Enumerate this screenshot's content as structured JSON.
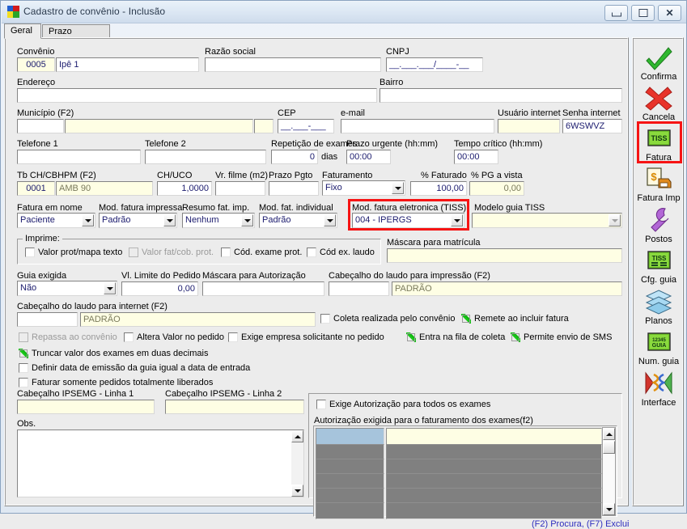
{
  "window": {
    "title": "Cadastro de convênio - Inclusão",
    "buttons": {
      "minimize": "—",
      "maximize": "❐",
      "close": "✕"
    }
  },
  "tabs": [
    {
      "label": "Geral",
      "active": true
    },
    {
      "label": "Prazo Entrega",
      "active": false
    }
  ],
  "form": {
    "convenio_label": "Convênio",
    "convenio_code": "0005",
    "convenio_name": "Ipê 1",
    "razao_social_label": "Razão social",
    "razao_social_value": "",
    "cnpj_label": "CNPJ",
    "cnpj_value": "__.___.___/____-__",
    "endereco_label": "Endereço",
    "endereco_value": "",
    "bairro_label": "Bairro",
    "bairro_value": "",
    "municipio_label": "Município (F2)",
    "municipio_code": "",
    "municipio_name": "",
    "municipio_uf": "",
    "cep_label": "CEP",
    "cep_value": "__.___-___",
    "email_label": "e-mail",
    "email_value": "",
    "usuario_internet_label": "Usuário internet",
    "usuario_internet_value": "",
    "senha_internet_label": "Senha internet",
    "senha_internet_value": "6WSWVZ",
    "telefone1_label": "Telefone 1",
    "telefone1_value": "",
    "telefone2_label": "Telefone 2",
    "telefone2_value": "",
    "repeticao_label": "Repetição de exames",
    "repeticao_value": "0",
    "repeticao_unit": "dias",
    "prazo_urgente_label": "Prazo urgente (hh:mm)",
    "prazo_urgente_value": "00:00",
    "tempo_critico_label": "Tempo crítico (hh:mm)",
    "tempo_critico_value": "00:00",
    "tb_ch_label": "Tb CH/CBHPM (F2)",
    "tb_ch_code": "0001",
    "tb_ch_name": "AMB 90",
    "ch_uco_label": "CH/UCO",
    "ch_uco_value": "1,0000",
    "vr_filme_label": "Vr. filme (m2)",
    "vr_filme_value": "",
    "prazo_pgto_label": "Prazo Pgto",
    "prazo_pgto_value": "",
    "faturamento_label": "Faturamento",
    "faturamento_value": "Fixo",
    "pct_faturado_label": "% Faturado",
    "pct_faturado_value": "100,00",
    "pct_pg_vista_label": "% PG a vista",
    "pct_pg_vista_value": "0,00",
    "fatura_em_nome_label": "Fatura em nome",
    "fatura_em_nome_value": "Paciente",
    "mod_fatura_impressa_label": "Mod. fatura impressa",
    "mod_fatura_impressa_value": "Padrão",
    "resumo_fat_label": "Resumo fat. imp.",
    "resumo_fat_value": "Nenhum",
    "mod_fat_individual_label": "Mod. fat. individual",
    "mod_fat_individual_value": "Padrão",
    "mod_fatura_eletronica_label": "Mod. fatura eletronica (TISS)",
    "mod_fatura_eletronica_value": "004 - IPERGS",
    "modelo_guia_tiss_label": "Modelo guia TISS",
    "modelo_guia_tiss_value": "",
    "imprime_group_label": "Imprime:",
    "imprime_checkboxes": [
      {
        "label": "Valor prot/mapa texto",
        "checked": false,
        "disabled": false
      },
      {
        "label": "Valor fat/cob. prot.",
        "checked": false,
        "disabled": true
      },
      {
        "label": "Cód. exame prot.",
        "checked": false,
        "disabled": false
      },
      {
        "label": "Cód  ex. laudo",
        "checked": false,
        "disabled": false
      }
    ],
    "mascara_matricula_label": "Máscara para matrícula",
    "mascara_matricula_value": "",
    "guia_exigida_label": "Guia exigida",
    "guia_exigida_value": "Não",
    "vl_limite_label": "Vl. Limite do Pedido",
    "vl_limite_value": "0,00",
    "mascara_autorizacao_label": "Máscara para Autorização",
    "mascara_autorizacao_value": "",
    "cab_laudo_impressao_label": "Cabeçalho do laudo para impressão (F2)",
    "cab_laudo_impressao_code": "",
    "cab_laudo_impressao_value": "PADRÃO",
    "cab_laudo_internet_label": "Cabeçalho do laudo para internet (F2)",
    "cab_laudo_internet_code": "",
    "cab_laudo_internet_value": "PADRÃO",
    "coleta_convenio_label": "Coleta realizada pelo convênio",
    "coleta_convenio_checked": false,
    "remete_incluir_fatura_label": "Remete ao incluir fatura",
    "remete_incluir_fatura_checked": true,
    "repassa_convenio_label": "Repassa ao convênio",
    "repassa_convenio_checked": false,
    "repassa_convenio_disabled": true,
    "altera_valor_label": "Altera Valor no pedido",
    "altera_valor_checked": false,
    "exige_empresa_label": "Exige empresa solicitante no pedido",
    "exige_empresa_checked": false,
    "entra_fila_coleta_label": "Entra na fila de coleta",
    "entra_fila_coleta_checked": true,
    "permite_sms_label": "Permite envio de SMS",
    "permite_sms_checked": true,
    "truncar_label": "Truncar valor dos exames em duas decimais",
    "truncar_checked": true,
    "definir_data_label": "Definir data de emissão da guia igual a data de entrada",
    "definir_data_checked": false,
    "faturar_somente_label": "Faturar somente pedidos totalmente liberados",
    "faturar_somente_checked": false,
    "cab_ipsemg1_label": "Cabeçalho IPSEMG - Linha 1",
    "cab_ipsemg1_value": "",
    "cab_ipsemg2_label": "Cabeçalho IPSEMG - Linha 2",
    "cab_ipsemg2_value": "",
    "obs_label": "Obs.",
    "obs_value": "",
    "exige_autorizacao_label": "Exige Autorização para todos os exames",
    "exige_autorizacao_checked": false,
    "autorizacao_grid_label": "Autorização exigida para o faturamento dos exames(f2)",
    "grid_rows": [
      {
        "col1": "",
        "col2": "",
        "selected": true
      },
      {
        "col1": "",
        "col2": "",
        "selected": false
      },
      {
        "col1": "",
        "col2": "",
        "selected": false
      },
      {
        "col1": "",
        "col2": "",
        "selected": false
      },
      {
        "col1": "",
        "col2": "",
        "selected": false
      },
      {
        "col1": "",
        "col2": "",
        "selected": false
      }
    ],
    "grid_hint": "(F2) Procura, (F7) Exclui"
  },
  "sidebar": {
    "items": [
      {
        "label": "Confirma",
        "icon": "check-icon"
      },
      {
        "label": "Cancela",
        "icon": "cross-icon"
      },
      {
        "label": "Fatura",
        "icon": "tiss-icon",
        "highlighted": true
      },
      {
        "label": "Fatura Imp",
        "icon": "invoice-printer-icon"
      },
      {
        "label": "Postos",
        "icon": "wrench-icon"
      },
      {
        "label": "Cfg. guia",
        "icon": "tiss-config-icon"
      },
      {
        "label": "Planos",
        "icon": "layers-icon"
      },
      {
        "label": "Num. guia",
        "icon": "guia-number-icon"
      },
      {
        "label": "Interface",
        "icon": "interface-icon"
      }
    ]
  },
  "colors": {
    "highlight_red": "#f61414",
    "readonly_field": "#fefee4",
    "grid_cell": "#808080",
    "grid_selected": "#a6c4dc",
    "hint_text": "#2d2dbe"
  }
}
